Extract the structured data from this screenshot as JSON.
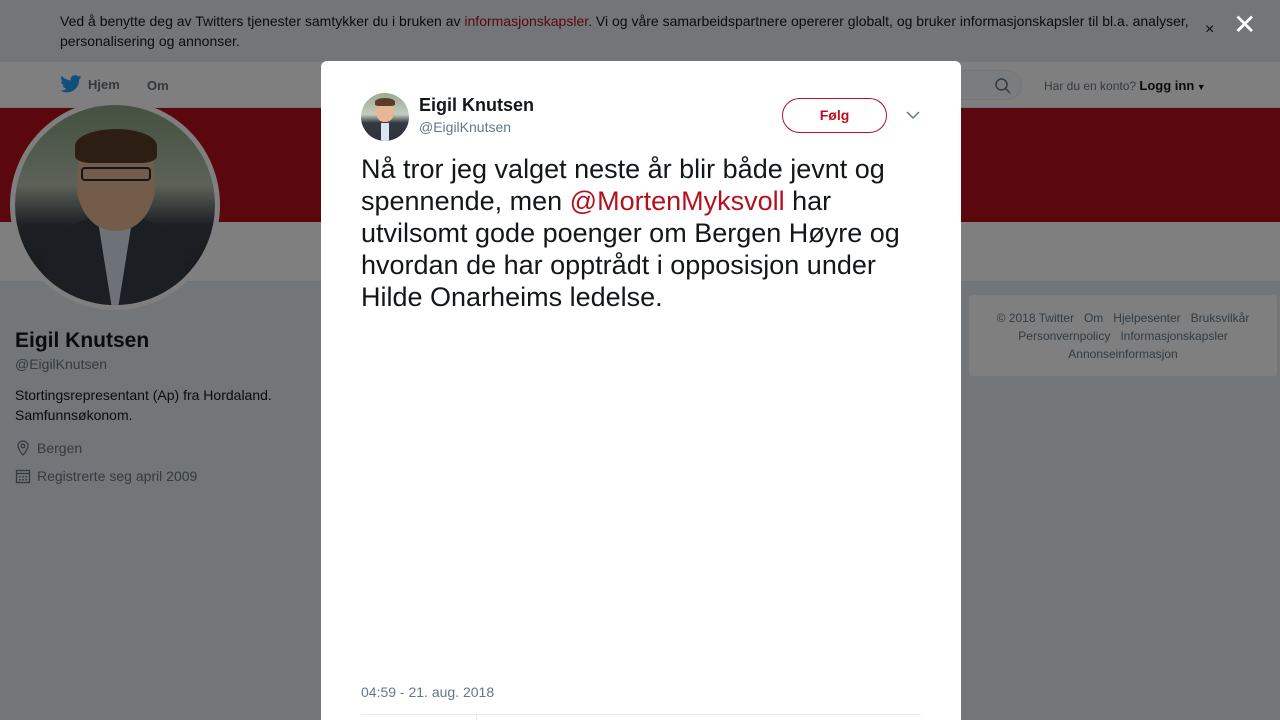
{
  "cookie_banner": {
    "text_before": "Ved å benytte deg av Twitters tjenester samtykker du i bruken av ",
    "link": "informasjonskapsler",
    "text_after": ". Vi og våre samarbeidspartnere opererer globalt, og bruker informasjonskapsler til bl.a. analyser, personalisering og annonser.",
    "close": "×"
  },
  "nav": {
    "home": "Hjem",
    "about": "Om",
    "login_prompt": "Har du en konto?",
    "login": "Logg inn"
  },
  "profile": {
    "name": "Eigil Knutsen",
    "handle": "@EigilKnutsen",
    "bio": "Stortingsrepresentant (Ap) fra Hordaland. Samfunnsøkonom.",
    "location": "Bergen",
    "joined": "Registrerte seg april 2009"
  },
  "footer": {
    "links": [
      "© 2018 Twitter",
      "Om",
      "Hjelpesenter",
      "Bruksvilkår",
      "Personvernpolicy",
      "Informasjonskapsler",
      "Annonseinformasjon"
    ]
  },
  "modal": {
    "close": "✕",
    "name": "Eigil Knutsen",
    "handle": "@EigilKnutsen",
    "follow": "Følg",
    "text_before": "Nå tror jeg valget neste år blir både jevnt og spennende, men ",
    "mention": "@MortenMyksvoll",
    "text_after": " har utvilsomt gode poenger om Bergen Høyre og hvordan de har opptrådt i opposisjon under Hilde Onarheims ledelse.",
    "timestamp": "04:59 - 21. aug. 2018"
  },
  "colors": {
    "brand": "#b5111d",
    "twitter_blue": "#1da1f2"
  }
}
